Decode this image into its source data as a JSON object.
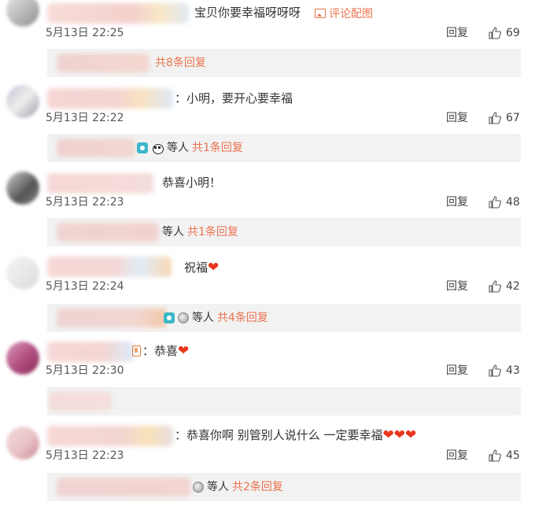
{
  "colors": {
    "accent": "#eb7350",
    "heart": "#e8361c",
    "reply_bg": "#f2f2f2"
  },
  "comments": [
    {
      "text": "宝贝你要幸福呀呀呀",
      "image_link": "评论配图",
      "time": "5月13日 22:25",
      "reply_label": "回复",
      "likes": "69",
      "sub_reply": {
        "others": "",
        "count_text": "共8条回复"
      }
    },
    {
      "text": "：小明，要开心要幸福",
      "time": "5月13日 22:22",
      "reply_label": "回复",
      "likes": "67",
      "sub_reply": {
        "others": "等人",
        "count_text": "共1条回复"
      }
    },
    {
      "text": "恭喜小明！",
      "time": "5月13日 22:23",
      "reply_label": "回复",
      "likes": "48",
      "sub_reply": {
        "others": "等人",
        "count_text": "共1条回复"
      }
    },
    {
      "text": "祝福",
      "hearts": "❤",
      "time": "5月13日 22:24",
      "reply_label": "回复",
      "likes": "42",
      "sub_reply": {
        "others": "等人",
        "count_text": "共4条回复"
      }
    },
    {
      "text": "：恭喜",
      "hearts": "❤",
      "time": "5月13日 22:30",
      "reply_label": "回复",
      "likes": "43"
    },
    {
      "text": "：恭喜你啊 别管别人说什么 一定要幸福",
      "hearts": "❤❤❤",
      "time": "5月13日 22:23",
      "reply_label": "回复",
      "likes": "45",
      "sub_reply": {
        "others": "等人",
        "count_text": "共2条回复"
      }
    }
  ]
}
